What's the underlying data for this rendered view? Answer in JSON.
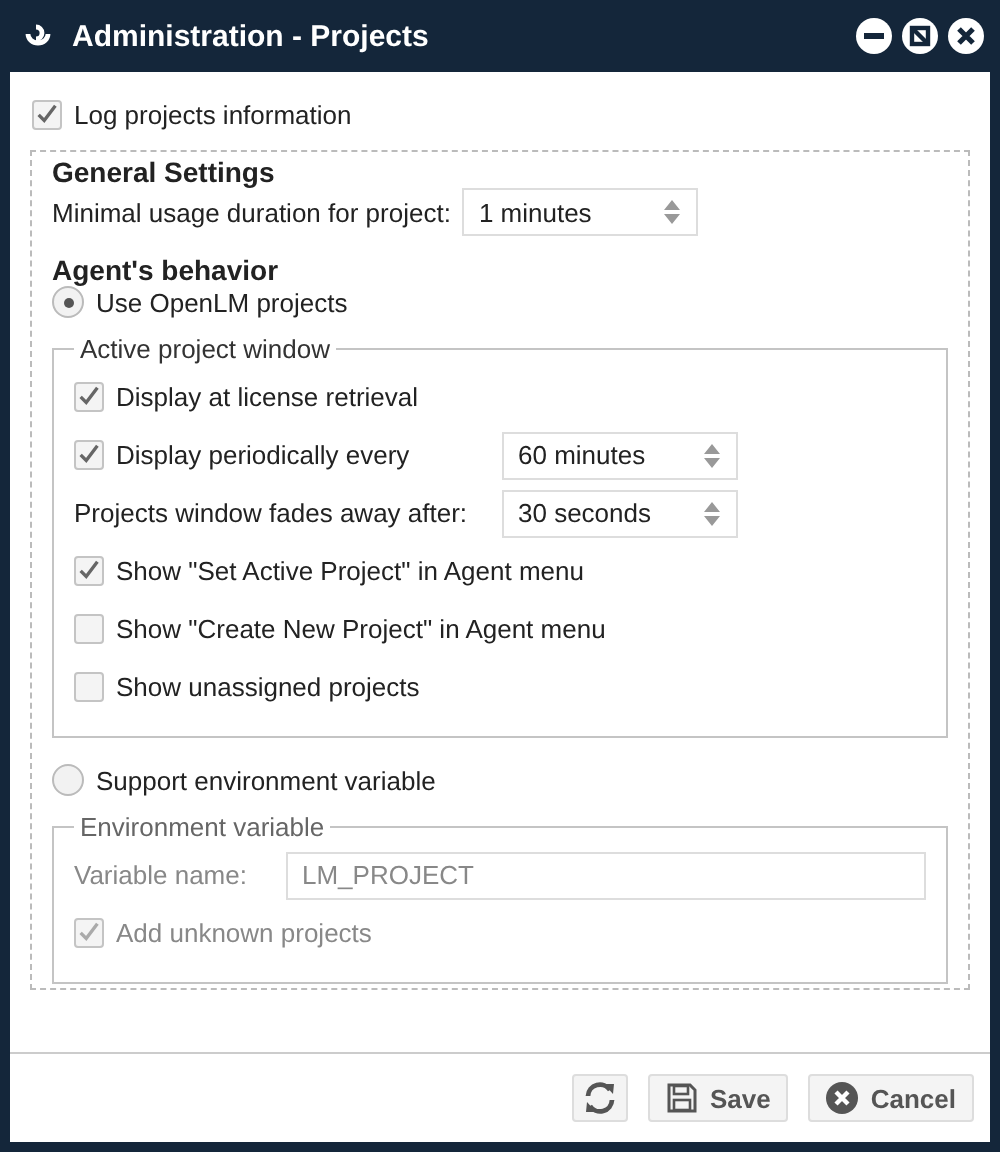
{
  "window": {
    "title": "Administration - Projects"
  },
  "log_projects": {
    "label": "Log projects information",
    "checked": true
  },
  "general_settings": {
    "title": "General Settings",
    "label": "Minimal usage duration for project:",
    "value": "1 minutes"
  },
  "agent_behavior": {
    "title": "Agent's behavior",
    "use_openlm": {
      "label": "Use OpenLM projects",
      "selected": true
    },
    "active_project_window": {
      "legend": "Active project window",
      "items": [
        {
          "kind": "checkbox",
          "label": "Display at license retrieval",
          "checked": true
        },
        {
          "kind": "checkbox-spinner",
          "label": "Display periodically every",
          "checked": true,
          "value": "60 minutes"
        },
        {
          "kind": "spinner",
          "label": "Projects window fades away after:",
          "value": "30 seconds"
        },
        {
          "kind": "checkbox",
          "label": "Show \"Set Active Project\" in Agent menu",
          "checked": true
        },
        {
          "kind": "checkbox",
          "label": "Show \"Create New Project\" in Agent menu",
          "checked": false
        },
        {
          "kind": "checkbox",
          "label": "Show unassigned projects",
          "checked": false
        }
      ]
    },
    "support_env": {
      "label": "Support environment variable",
      "selected": false
    },
    "environment_variable": {
      "legend": "Environment variable",
      "disabled": true,
      "field_label": "Variable name:",
      "field_value": "LM_PROJECT",
      "add_unknown": {
        "label": "Add unknown projects",
        "checked": true
      }
    }
  },
  "buttons": [
    {
      "kind": "refresh"
    },
    {
      "kind": "save",
      "label": "Save"
    },
    {
      "kind": "cancel",
      "label": "Cancel"
    }
  ]
}
